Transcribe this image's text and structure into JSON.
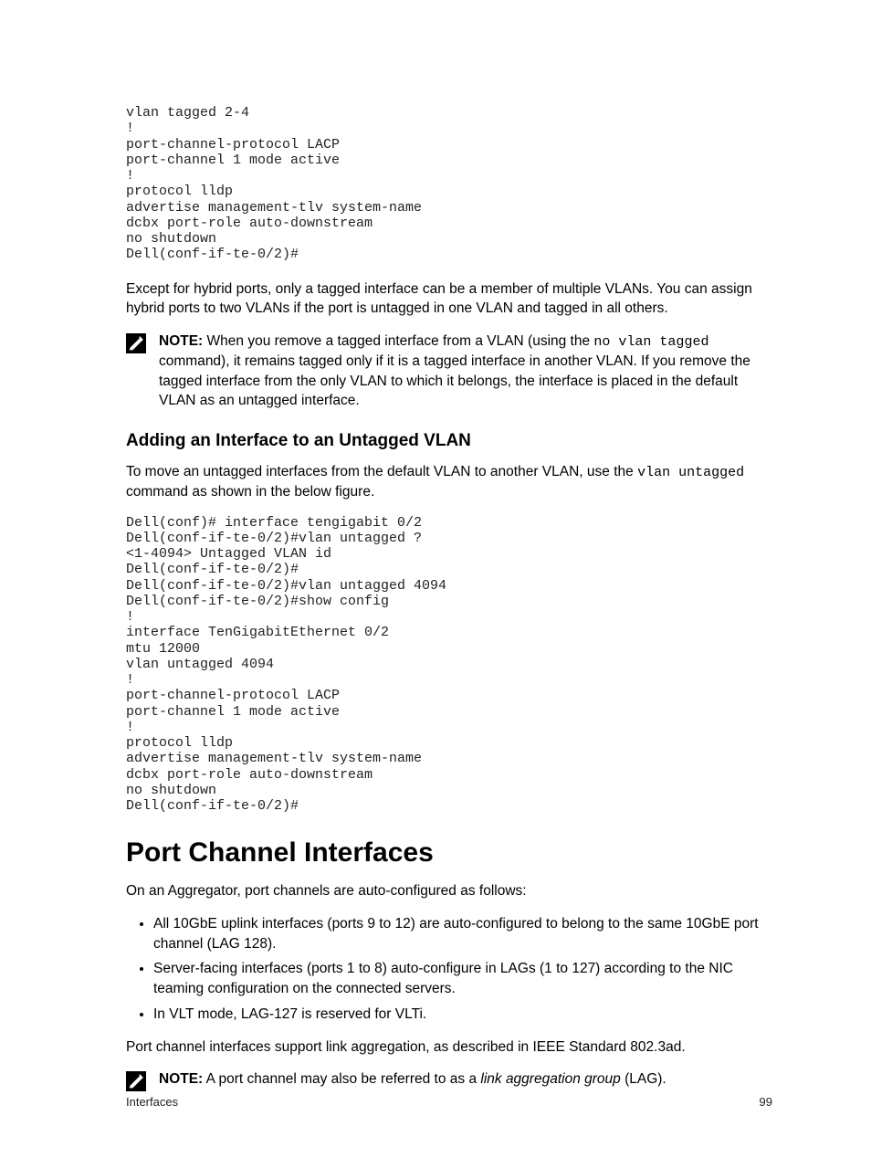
{
  "code_block_1": "vlan tagged 2-4\n!\nport-channel-protocol LACP\nport-channel 1 mode active\n!\nprotocol lldp\nadvertise management-tlv system-name\ndcbx port-role auto-downstream\nno shutdown\nDell(conf-if-te-0/2)#",
  "para_1": "Except for hybrid ports, only a tagged interface can be a member of multiple VLANs. You can assign hybrid ports to two VLANs if the port is untagged in one VLAN and tagged in all others.",
  "note_1": {
    "label": "NOTE:",
    "pre": " When you remove a tagged interface from a VLAN (using the ",
    "mono": "no vlan tagged",
    "post": " command), it remains tagged only if it is a tagged interface in another VLAN. If you remove the tagged interface from the only VLAN to which it belongs, the interface is placed in the default VLAN as an untagged interface."
  },
  "subheading_1": "Adding an Interface to an Untagged VLAN",
  "para_2_pre": "To move an untagged interfaces from the default VLAN to another VLAN, use the ",
  "para_2_mono": "vlan untagged",
  "para_2_post": " command as shown in the below figure.",
  "code_block_2": "Dell(conf)# interface tengigabit 0/2\nDell(conf-if-te-0/2)#vlan untagged ?\n<1-4094> Untagged VLAN id\nDell(conf-if-te-0/2)#\nDell(conf-if-te-0/2)#vlan untagged 4094\nDell(conf-if-te-0/2)#show config\n!\ninterface TenGigabitEthernet 0/2\nmtu 12000\nvlan untagged 4094\n!\nport-channel-protocol LACP\nport-channel 1 mode active\n!\nprotocol lldp\nadvertise management-tlv system-name\ndcbx port-role auto-downstream\nno shutdown\nDell(conf-if-te-0/2)#",
  "heading_1": "Port Channel Interfaces",
  "para_3": "On an Aggregator, port channels are auto-configured as follows:",
  "bullets": [
    "All 10GbE uplink interfaces (ports 9 to 12) are auto-configured to belong to the same 10GbE port channel (LAG 128).",
    "Server-facing interfaces (ports 1 to 8) auto-configure in LAGs (1 to 127) according to the NIC teaming configuration on the connected servers.",
    "In VLT mode, LAG-127 is reserved for VLTi."
  ],
  "para_4": "Port channel interfaces support link aggregation, as described in IEEE Standard 802.3ad.",
  "note_2": {
    "label": "NOTE:",
    "pre": " A port channel may also be referred to as a ",
    "em": "link aggregation group",
    "post": " (LAG)."
  },
  "footer": {
    "left": "Interfaces",
    "right": "99"
  }
}
